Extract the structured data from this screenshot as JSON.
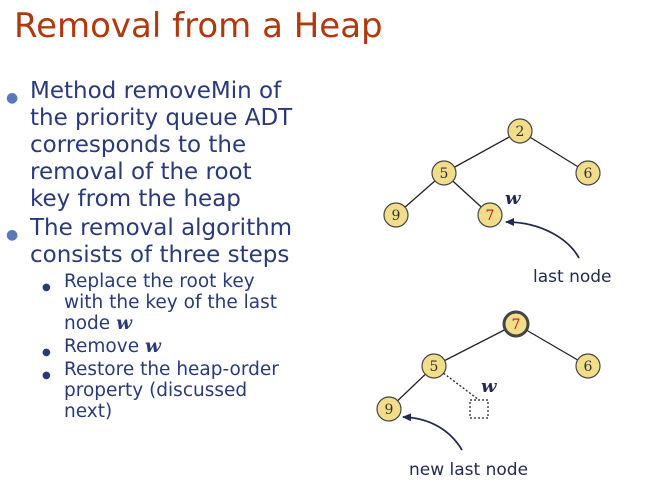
{
  "title": "Removal from a Heap",
  "bullets": {
    "b1_lines": [
      "Method removeMin of",
      "the priority queue ADT",
      "corresponds to the",
      "removal of the root",
      "key from the heap"
    ],
    "b2_lines": [
      "The removal algorithm",
      "consists of three steps"
    ],
    "sub1_lines": [
      "Replace the root key",
      "with the key of the last"
    ],
    "sub1_tail": "node ",
    "sub1_var": "w",
    "sub2_text": "Remove ",
    "sub2_var": "w",
    "sub3_lines": [
      "Restore the heap-order",
      "property (discussed",
      "next)"
    ]
  },
  "diagram1": {
    "nodes": {
      "root": "2",
      "left": "5",
      "right": "6",
      "ll": "9",
      "lr": "7"
    },
    "w_label": "w",
    "caption": "last node"
  },
  "diagram2": {
    "nodes": {
      "root": "7",
      "left": "5",
      "right": "6",
      "ll": "9"
    },
    "w_label": "w",
    "caption": "new last node"
  },
  "colors": {
    "title": "#b03a0f",
    "text": "#2a3a78",
    "node_fill": "#f2dd8a",
    "highlight_key": "#cc1111"
  }
}
